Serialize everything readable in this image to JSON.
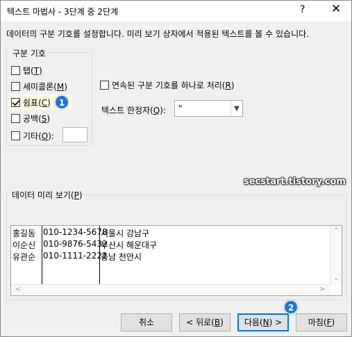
{
  "window": {
    "title": "텍스트 마법사 - 3단계 중 2단계",
    "help_label": "?",
    "close_label": "✕"
  },
  "description": "데이터의 구분 기호를 설정합니다. 미리 보기 상자에서 적용된 텍스트를 볼 수 있습니다.",
  "delimiters": {
    "group_title": "구분 기호",
    "items": [
      {
        "label": "탭",
        "key": "T",
        "checked": false
      },
      {
        "label": "세미콜론",
        "key": "M",
        "checked": false
      },
      {
        "label": "쉼표",
        "key": "C",
        "checked": true
      },
      {
        "label": "공백",
        "key": "S",
        "checked": false
      },
      {
        "label": "기타",
        "key": "O",
        "checked": false
      }
    ],
    "other_value": ""
  },
  "consecutive": {
    "label": "연속된 구분 기호를 하나로 처리",
    "key": "R",
    "checked": false
  },
  "text_qualifier": {
    "label": "텍스트 한정자",
    "key": "Q",
    "value": "\""
  },
  "watermark": "secstart.tistory.com",
  "preview": {
    "title": "데이터 미리 보기",
    "key": "P",
    "rows": [
      [
        "홍길동",
        "010-1234-5678",
        "서울시 강남구"
      ],
      [
        "이순신",
        "010-9876-5432",
        "부산시 해운대구"
      ],
      [
        "유관순",
        "010-1111-2222",
        "충남 천안시"
      ]
    ]
  },
  "buttons": {
    "cancel": "취소",
    "back": "< 뒤로(",
    "back_key": "B",
    "next": "다음(",
    "next_key": "N",
    "next_suffix": ") >",
    "finish": "마침(",
    "finish_key": "F"
  },
  "callouts": [
    "1",
    "2"
  ],
  "colors": {
    "accent": "#0078d7",
    "badge": "#1e74d8"
  }
}
